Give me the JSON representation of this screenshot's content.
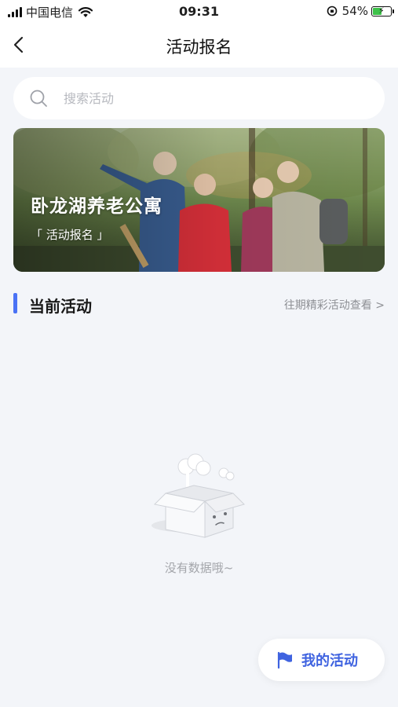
{
  "status": {
    "carrier": "中国电信",
    "time": "09:31",
    "battery": "54%",
    "battery_level": 0.54
  },
  "nav": {
    "title": "活动报名",
    "back_icon": "chevron-left-icon"
  },
  "search": {
    "placeholder": "搜索活动",
    "icon": "search-icon"
  },
  "banner": {
    "title": "卧龙湖养老公寓",
    "subtitle": "「 活动报名 」"
  },
  "section": {
    "title": "当前活动",
    "link": "往期精彩活动查看 >"
  },
  "empty": {
    "text": "没有数据哦~",
    "icon": "empty-box-icon"
  },
  "fab": {
    "label": "我的活动",
    "icon": "flag-icon"
  },
  "colors": {
    "accent": "#4a72f5",
    "fab_text": "#3f63e0",
    "background": "#f3f5f9"
  }
}
